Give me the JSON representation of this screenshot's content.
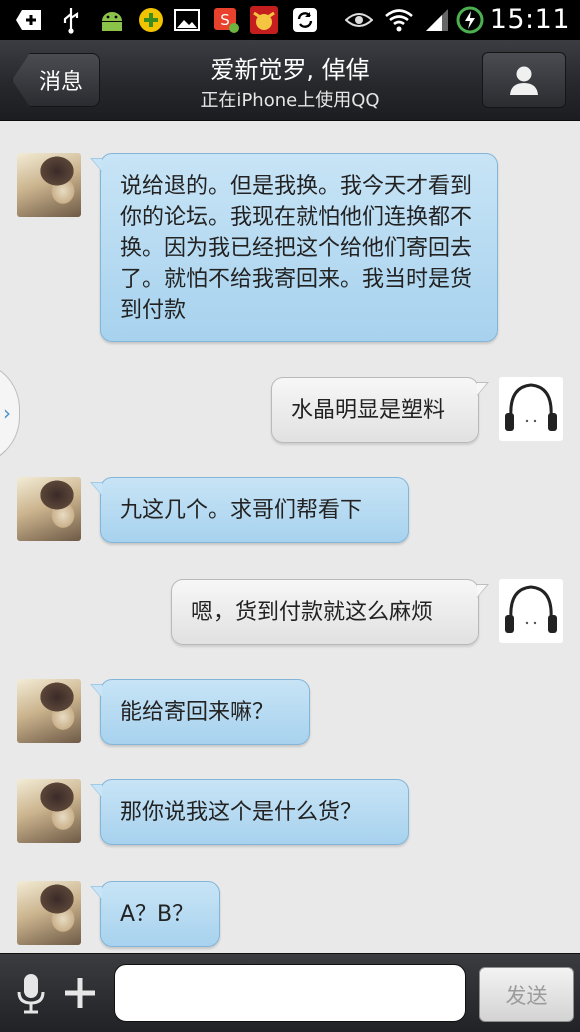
{
  "status_bar": {
    "time": "15:11",
    "icons": [
      "add-icon",
      "usb-icon",
      "android-icon",
      "plus-app-icon",
      "image-icon",
      "office-app-icon",
      "bull-app-icon",
      "sync-icon",
      "eye-icon",
      "wifi-icon",
      "signal-icon",
      "battery-charging-icon"
    ]
  },
  "header": {
    "back_label": "消息",
    "title": "爱新觉罗, 倬倬",
    "subtitle": "正在iPhone上使用QQ"
  },
  "messages": [
    {
      "side": "left",
      "text": "说给退的。但是我换。我今天才看到你的论坛。我现在就怕他们连换都不换。因为我已经把这个给他们寄回去了。就怕不给我寄回来。我当时是货到付款"
    },
    {
      "side": "right",
      "text": "水晶明显是塑料"
    },
    {
      "side": "left",
      "text": "九这几个。求哥们帮看下"
    },
    {
      "side": "right",
      "text": "嗯，货到付款就这么麻烦"
    },
    {
      "side": "left",
      "text": "能给寄回来嘛？"
    },
    {
      "side": "left",
      "text": "那你说我这个是什么货？"
    },
    {
      "side": "left",
      "text": "A？B？"
    }
  ],
  "input_bar": {
    "placeholder": "",
    "send_label": "发送"
  },
  "colors": {
    "incoming_bubble": "#b8dbf2",
    "outgoing_bubble": "#eeeeee",
    "chat_background": "#e9e9e9",
    "header_background": "#2b2d31"
  }
}
